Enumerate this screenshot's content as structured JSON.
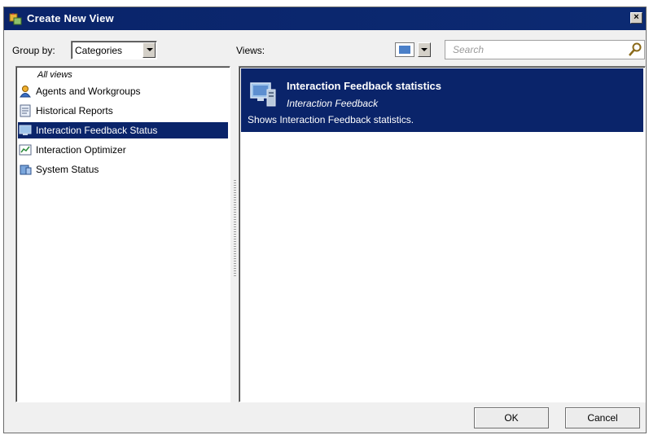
{
  "window": {
    "title": "Create New View",
    "close_label": "×"
  },
  "toolbar": {
    "group_by_label": "Group by:",
    "group_by_value": "Categories",
    "views_label": "Views:",
    "search_placeholder": "Search"
  },
  "tree": {
    "all_views_label": "All views",
    "items": [
      {
        "label": "Agents and Workgroups",
        "icon": "agents-icon",
        "selected": false
      },
      {
        "label": "Historical Reports",
        "icon": "report-icon",
        "selected": false
      },
      {
        "label": "Interaction Feedback Status",
        "icon": "monitor-icon",
        "selected": true
      },
      {
        "label": "Interaction Optimizer",
        "icon": "chart-icon",
        "selected": false
      },
      {
        "label": "System Status",
        "icon": "server-icon",
        "selected": false
      }
    ]
  },
  "views": {
    "items": [
      {
        "title": "Interaction Feedback statistics",
        "category": "Interaction Feedback",
        "description": "Shows Interaction Feedback statistics."
      }
    ]
  },
  "buttons": {
    "ok": "OK",
    "cancel": "Cancel"
  },
  "colors": {
    "titlebar": "#0a246a",
    "selection": "#0a246a"
  }
}
